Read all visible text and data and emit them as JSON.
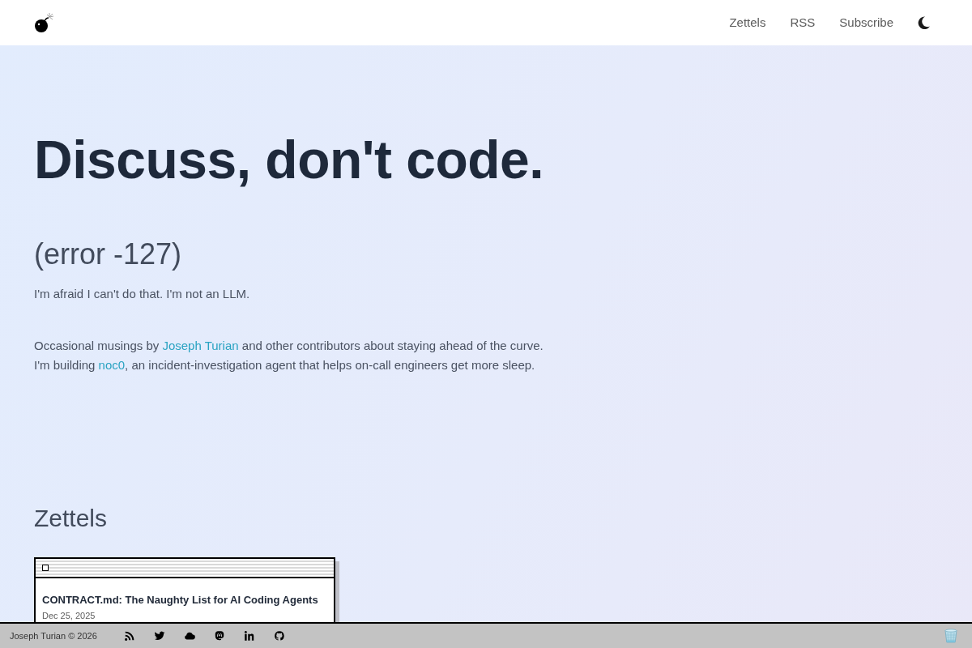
{
  "navbar": {
    "links": [
      {
        "label": "Zettels"
      },
      {
        "label": "RSS"
      },
      {
        "label": "Subscribe"
      }
    ]
  },
  "hero": {
    "title": "Discuss, don't code.",
    "subtitle": "(error -127)",
    "tagline": "I'm afraid I can't do that. I'm not an LLM."
  },
  "intro": [
    {
      "segments": [
        {
          "kind": "text",
          "text": "Occasional musings by "
        },
        {
          "kind": "link",
          "text": "Joseph Turian"
        },
        {
          "kind": "text",
          "text": " and other contributors about staying ahead of the curve."
        }
      ]
    },
    {
      "segments": [
        {
          "kind": "text",
          "text": "I'm building "
        },
        {
          "kind": "link",
          "text": "noc0"
        },
        {
          "kind": "text",
          "text": ", an incident-investigation agent that helps on-call engineers get more sleep."
        }
      ]
    }
  ],
  "zettels": {
    "heading": "Zettels",
    "cards": [
      {
        "title": "CONTRACT.md: The Naughty List for AI Coding Agents",
        "date": "Dec 25, 2025"
      }
    ]
  },
  "footer": {
    "copyright": "Joseph Turian © 2026"
  }
}
